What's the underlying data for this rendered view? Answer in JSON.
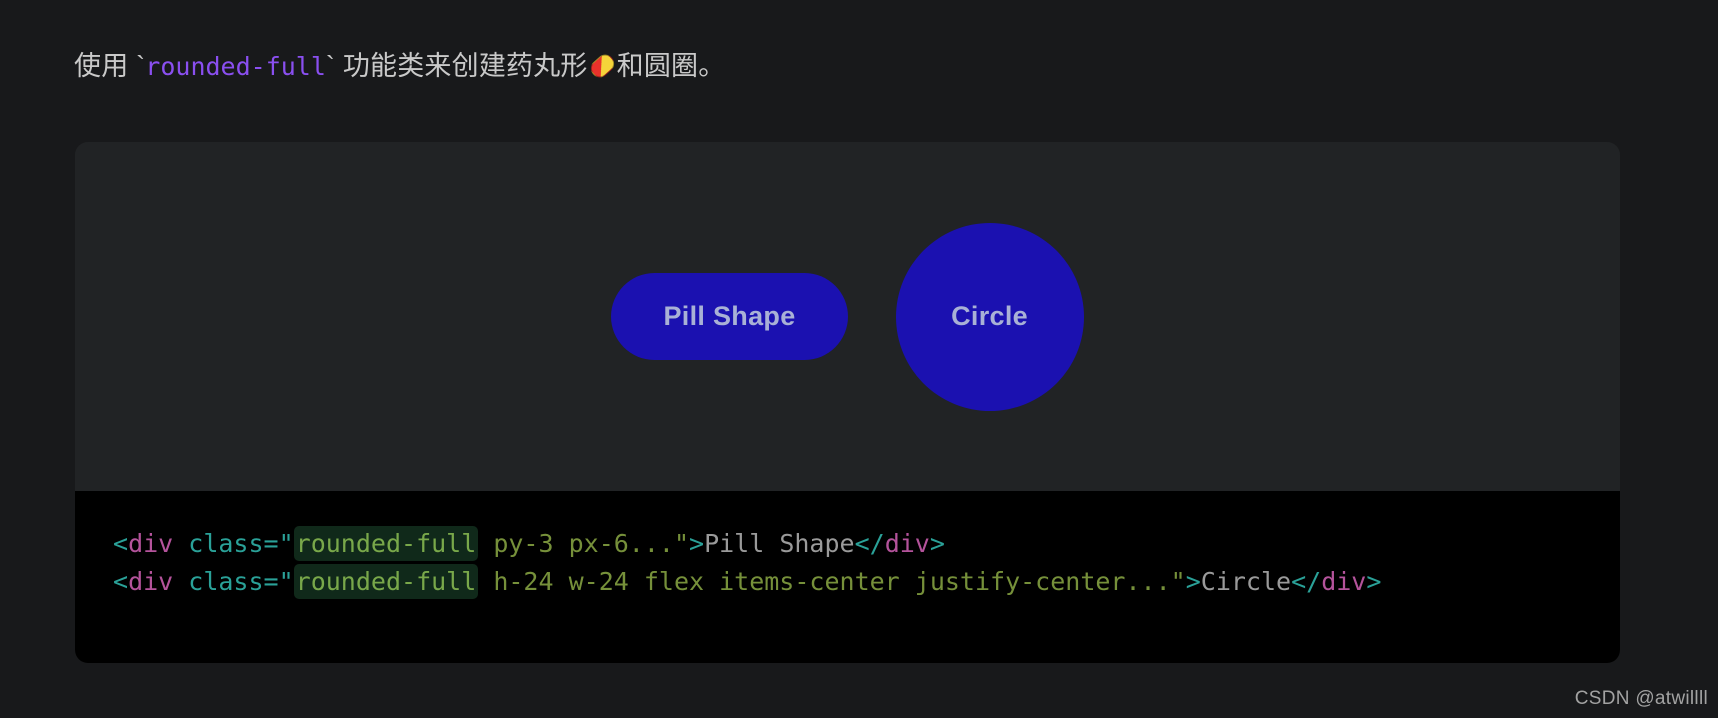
{
  "intro": {
    "before_code": "使用 `",
    "code": "rounded-full",
    "after_code": "` 功能类来创建药丸形",
    "emoji_name": "pill-emoji",
    "tail": "和圆圈。",
    "code_color": "#8a4ff0",
    "text_color": "#c9c9c9"
  },
  "demo": {
    "background": "#212325",
    "shape_color": "#1b11b0",
    "shape_text_color": "#a9b1d6",
    "pill_label": "Pill Shape",
    "circle_label": "Circle"
  },
  "code": {
    "background": "#000000",
    "highlight_background": "#10291a",
    "lines": [
      {
        "open_bracket": "<",
        "tag": "div",
        "space": " ",
        "attr": "class",
        "eq_quote": "=\"",
        "highlight": "rounded-full",
        "rest_value": " py-3 px-6...",
        "close_quote": "\"",
        "gt": ">",
        "text": "Pill Shape",
        "close_open": "</",
        "close_tag": "div",
        "close_gt": ">"
      },
      {
        "open_bracket": "<",
        "tag": "div",
        "space": " ",
        "attr": "class",
        "eq_quote": "=\"",
        "highlight": "rounded-full",
        "rest_value": " h-24 w-24 flex items-center justify-center...",
        "close_quote": "\"",
        "gt": ">",
        "text": "Circle",
        "close_open": "</",
        "close_tag": "div",
        "close_gt": ">"
      }
    ]
  },
  "watermark": {
    "text": "CSDN @atwillll"
  }
}
